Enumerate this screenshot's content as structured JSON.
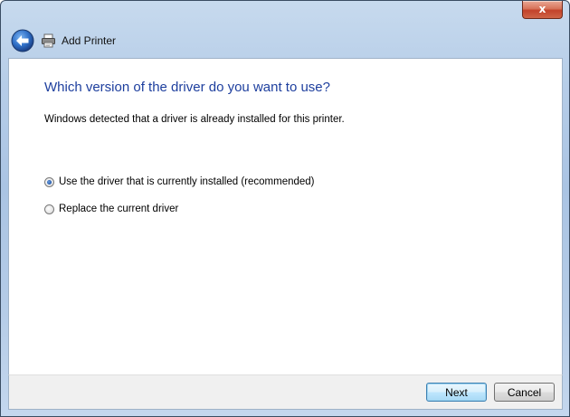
{
  "window": {
    "title": "Add Printer",
    "close_label": "x"
  },
  "icons": {
    "back": "back-arrow-icon",
    "printer": "printer-icon",
    "close": "close-icon"
  },
  "main": {
    "heading": "Which version of the driver do you want to use?",
    "description": "Windows detected that a driver is already installed for this printer.",
    "options": [
      {
        "label": "Use the driver that is currently installed (recommended)",
        "checked": true
      },
      {
        "label": "Replace the current driver",
        "checked": false
      }
    ]
  },
  "footer": {
    "next_label": "Next",
    "cancel_label": "Cancel"
  },
  "colors": {
    "heading": "#1e3f9e",
    "frame": "#b6cde8",
    "close": "#c2422a"
  }
}
